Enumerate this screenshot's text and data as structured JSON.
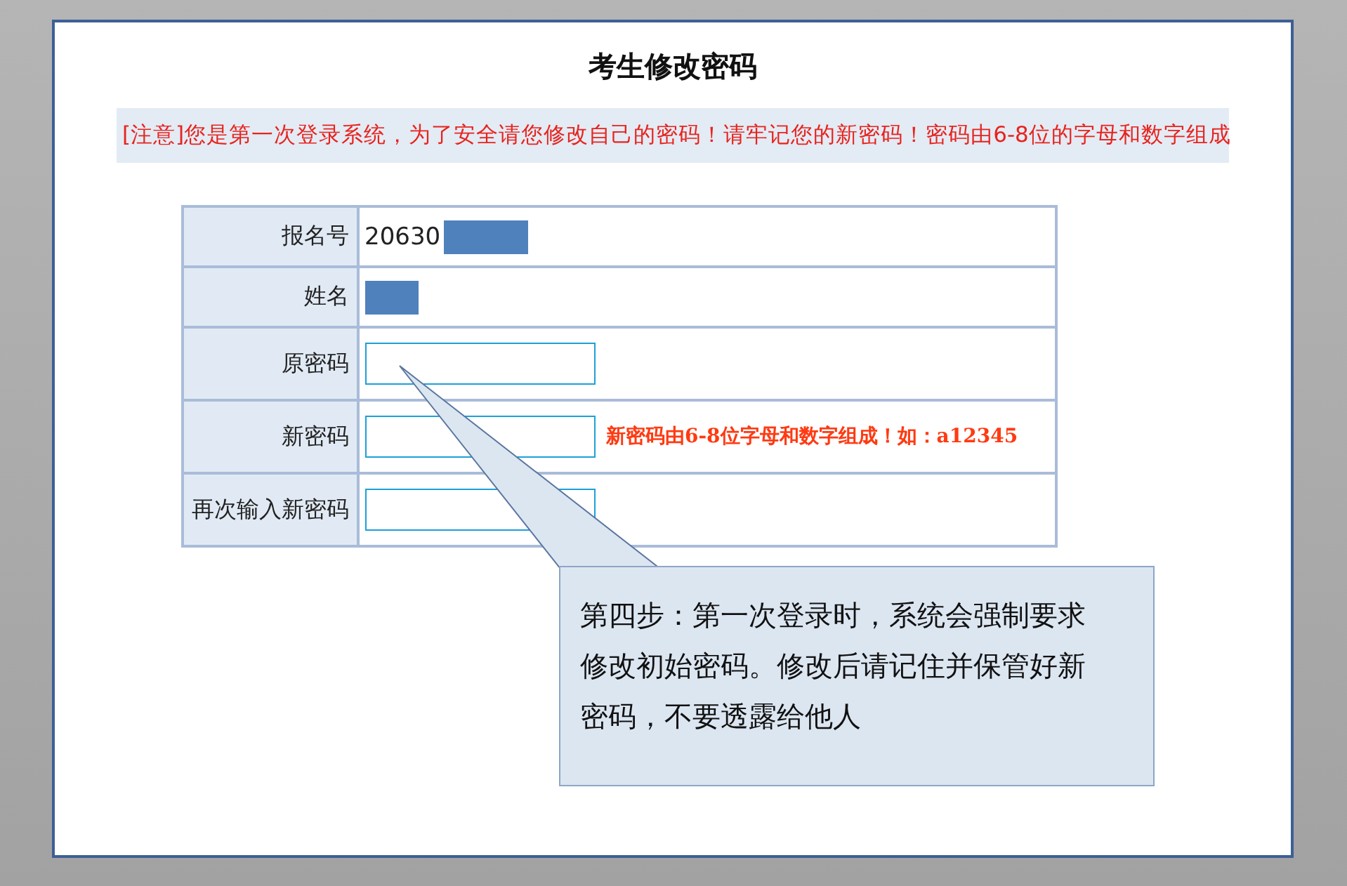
{
  "title": "考生修改密码",
  "notice": "[注意]您是第一次登录系统，为了安全请您修改自己的密码！请牢记您的新密码！密码由6-8位的字母和数字组成",
  "form": {
    "rows": [
      {
        "kind": "text",
        "label": "报名号",
        "value": "20630",
        "redacted": true
      },
      {
        "kind": "text",
        "label": "姓名",
        "redacted": true
      },
      {
        "kind": "password",
        "label": "原密码"
      },
      {
        "kind": "password",
        "label": "新密码",
        "hint": "新密码由6-8位字母和数字组成！如：a12345"
      },
      {
        "kind": "password",
        "label": "再次输入新密码"
      }
    ]
  },
  "callout": {
    "text": "第四步：第一次登录时，系统会强制要求修改初始密码。修改后请记住并保管好新密码，不要透露给他人"
  }
}
